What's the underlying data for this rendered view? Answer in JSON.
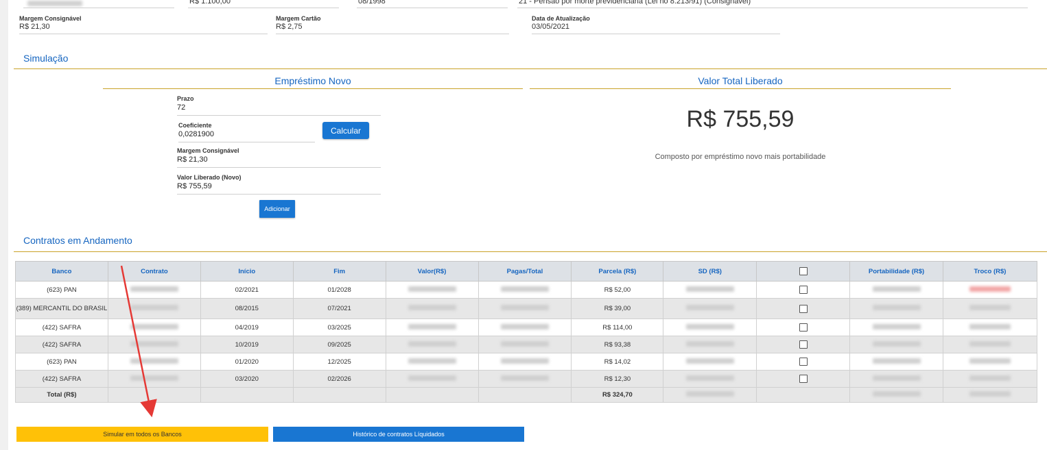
{
  "top_row": {
    "salario": "R$ 1.100,00",
    "data_inicio": "08/1998",
    "especie": "21 - Pensão por morte previdenciária (Lei no 8.213/91) (Consignável)"
  },
  "info": {
    "margem_consignavel": {
      "label": "Margem Consignável",
      "value": "R$ 21,30"
    },
    "margem_cartao": {
      "label": "Margem Cartão",
      "value": "R$ 2,75"
    },
    "data_atualizacao": {
      "label": "Data de Atualização",
      "value": "03/05/2021"
    }
  },
  "simulacao": {
    "title": "Simulação",
    "emprestimo_title": "Empréstimo Novo",
    "valor_total_title": "Valor Total Liberado",
    "prazo": {
      "label": "Prazo",
      "value": "72"
    },
    "coeficiente": {
      "label": "Coeficiente",
      "value": "0,0281900"
    },
    "margem": {
      "label": "Margem Consignável",
      "value": "R$ 21,30"
    },
    "valor_liberado": {
      "label": "Valor Liberado (Novo)",
      "value": "R$ 755,59"
    },
    "calcular_label": "Calcular",
    "adicionar_label": "Adicionar",
    "valor_total": "R$ 755,59",
    "valor_total_note": "Composto por empréstimo novo mais portabilidade"
  },
  "contratos": {
    "title": "Contratos em Andamento",
    "headers": [
      "Banco",
      "Contrato",
      "Início",
      "Fim",
      "Valor(R$)",
      "Pagas/Total",
      "Parcela (R$)",
      "SD (R$)",
      "",
      "Portabilidade (R$)",
      "Troco (R$)"
    ],
    "rows": [
      {
        "banco": "(623) PAN",
        "inicio": "02/2021",
        "fim": "01/2028",
        "parcela": "R$ 52,00"
      },
      {
        "banco": "(389) MERCANTIL DO BRASIL",
        "inicio": "08/2015",
        "fim": "07/2021",
        "parcela": "R$ 39,00"
      },
      {
        "banco": "(422) SAFRA",
        "inicio": "04/2019",
        "fim": "03/2025",
        "parcela": "R$ 114,00"
      },
      {
        "banco": "(422) SAFRA",
        "inicio": "10/2019",
        "fim": "09/2025",
        "parcela": "R$ 93,38"
      },
      {
        "banco": "(623) PAN",
        "inicio": "01/2020",
        "fim": "12/2025",
        "parcela": "R$ 14,02"
      },
      {
        "banco": "(422) SAFRA",
        "inicio": "03/2020",
        "fim": "02/2026",
        "parcela": "R$ 12,30"
      }
    ],
    "total_label": "Total (R$)",
    "total_parcela": "R$ 324,70"
  },
  "buttons": {
    "simular_todos": "Simular em todos os Bancos",
    "historico": "Histórico de contratos Líquidados"
  },
  "colors": {
    "accent_blue": "#1976d2",
    "title_blue": "#1565c0",
    "gold_line": "#c9a227",
    "yellow_button": "#ffc107",
    "annotation_arrow": "#e53935"
  }
}
